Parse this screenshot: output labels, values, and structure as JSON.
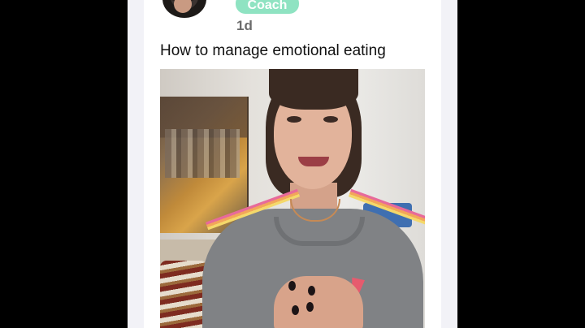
{
  "post": {
    "author_badge": "Coach",
    "age": "1d",
    "title": "How to manage emotional eating"
  },
  "colors": {
    "badge_bg": "#8fe3c2",
    "background": "#000000",
    "card": "#ffffff",
    "page": "#f2f2f7"
  }
}
